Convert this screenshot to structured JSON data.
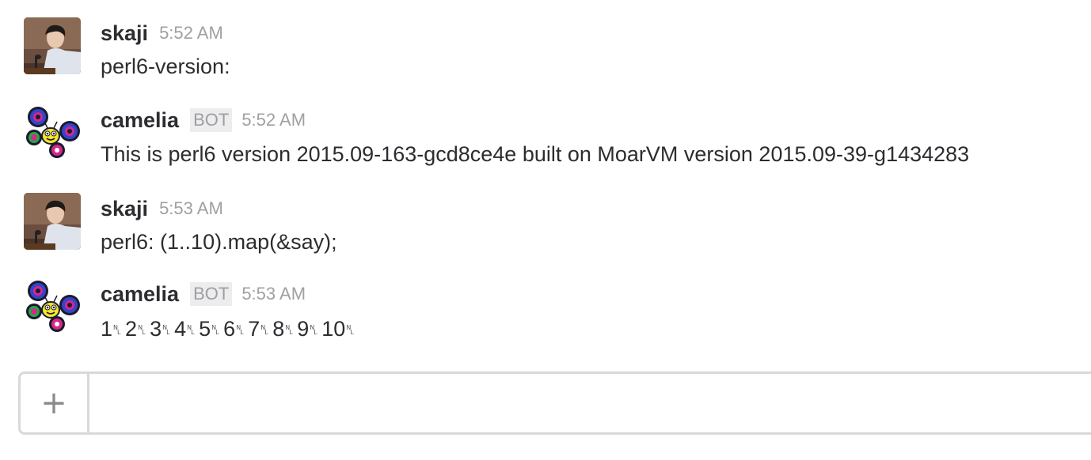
{
  "messages": [
    {
      "author": "skaji",
      "is_bot": false,
      "time": "5:52 AM",
      "text": "perl6-version:",
      "avatar": "user-photo"
    },
    {
      "author": "camelia",
      "is_bot": true,
      "bot_label": "BOT",
      "time": "5:52 AM",
      "text": "This is perl6 version 2015.09-163-gcd8ce4e built on MoarVM version 2015.09-39-g1434283",
      "avatar": "camelia-butterfly"
    },
    {
      "author": "skaji",
      "is_bot": false,
      "time": "5:53 AM",
      "text": "perl6: (1..10).map(&say);",
      "avatar": "user-photo"
    },
    {
      "author": "camelia",
      "is_bot": true,
      "bot_label": "BOT",
      "time": "5:53 AM",
      "output_values": [
        "1",
        "2",
        "3",
        "4",
        "5",
        "6",
        "7",
        "8",
        "9",
        "10"
      ],
      "newline_symbol": "NL",
      "avatar": "camelia-butterfly"
    }
  ],
  "composer": {
    "add_icon": "+",
    "input_value": "",
    "input_placeholder": ""
  }
}
